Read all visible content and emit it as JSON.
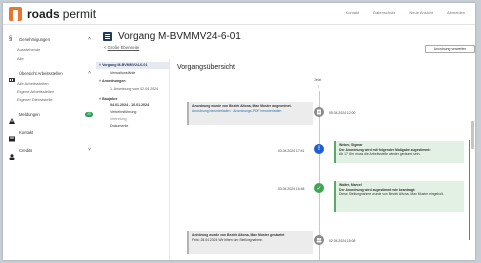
{
  "brand": {
    "bold": "roads",
    "light": "permit"
  },
  "top_nav": [
    "Kontakt",
    "Datenschutz",
    "Neue Ansicht",
    "Abmelden"
  ],
  "sidebar": {
    "groups": [
      {
        "label": "Genehmigungen",
        "icon": "paragraph-icon",
        "subs": [
          "Ausstehende",
          "Alle"
        ]
      },
      {
        "label": "Übersicht Arbeitsstellen",
        "icon": "construction-icon",
        "subs": [
          "Alle Arbeitsstellen",
          "Eigene Arbeitsstellen",
          "Eigener Dienststelle"
        ]
      },
      {
        "label": "Meldungen",
        "icon": "warning-icon",
        "badge": "20"
      },
      {
        "label": "Kontakt",
        "icon": "contact-icon"
      },
      {
        "label": "Credits",
        "icon": "credits-icon"
      }
    ]
  },
  "vorgang": {
    "title": "Vorgang M-BVMMV24-6-01",
    "back_prefix": "< ",
    "back_link": "Große Ebenseite",
    "button": "Anordnung verwerfen"
  },
  "tree": {
    "items": [
      "Vorgang M-BVMMV24-6-01",
      "Verwaltunsfähle",
      "Anordnungen",
      "1. Anordnung vom 02.04.2024",
      "Baujahre",
      "04.01.2024 - 10.01.2024",
      "Verkehrsführung",
      "Vertretung",
      "Dokumente"
    ]
  },
  "main": {
    "heading": "Vorgangsübersicht",
    "jetzt": "Jetzt",
    "events": [
      {
        "date": "05.04.2024 12:00",
        "kind": "gray",
        "title": "Anordnung wurde von Bezirk Altona, Max Muster angeordnet.",
        "links": "Anordnung herunterladen · Anordnungs-PDF herunterladen"
      },
      {
        "date": "03.04.2024 17:41",
        "kind": "blue",
        "title": "Weber, Sigmar",
        "body": "Der Anordnung wird mit folgender Maßgabe zugestimmt:",
        "body2": "Ab 17 Uhr muss die Arbeitsstelle wieder geräumt sein."
      },
      {
        "date": "03.04.2024 15:48",
        "kind": "green",
        "title": "Walter, Marcel",
        "body": "Der Anordnung wird zugestimmt wie beantragt:",
        "body2": "Diese Stellungnahme wurde von Bezirk Altona, Max Muster eingeholt."
      },
      {
        "date": "02.04.2024 15:08",
        "kind": "gray",
        "title": "Anhörung wurde von Bezirk Altona, Max Muster gestartet",
        "body": "Frist: 28.04.2024",
        "body2": "Wir bitten um Stellungnahme."
      }
    ]
  },
  "colors": {
    "brand": "#e8772e",
    "node_gray": "#8a8a8a",
    "node_blue": "#1f5ed6",
    "node_green": "#3fa552"
  }
}
